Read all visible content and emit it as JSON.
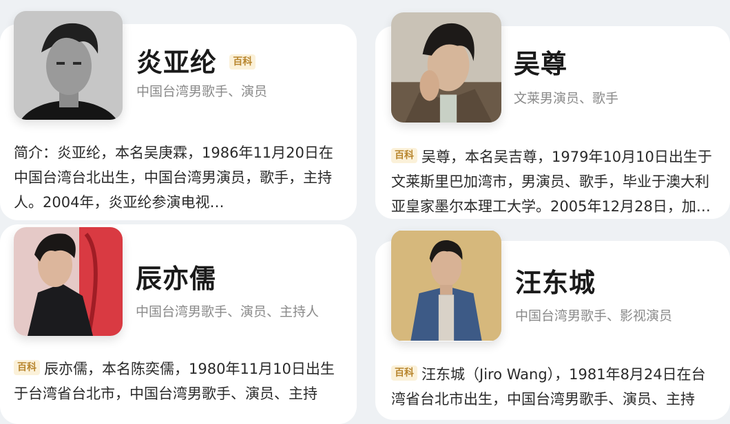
{
  "cards": [
    {
      "name": "炎亚纶",
      "badge": "百科",
      "subtitle": "中国台湾男歌手、演员",
      "desc_prefix": "简介：",
      "desc": "炎亚纶，本名吴庚霖，1986年11月20日在中国台湾台北出生，中国台湾男演员，歌手，主持人。2004年，炎亚纶参演电视…"
    },
    {
      "name": "吴尊",
      "subtitle": "文莱男演员、歌手",
      "badge": "百科",
      "desc": "吴尊，本名吴吉尊，1979年10月10日出生于文莱斯里巴加湾市，男演员、歌手，毕业于澳大利亚皇家墨尔本理工大学。2005年12月28日，加…"
    },
    {
      "name": "辰亦儒",
      "subtitle": "中国台湾男歌手、演员、主持人",
      "badge": "百科",
      "desc": "辰亦儒，本名陈奕儒，1980年11月10日出生于台湾省台北市，中国台湾男歌手、演员、主持"
    },
    {
      "name": "汪东城",
      "subtitle": "中国台湾男歌手、影视演员",
      "badge": "百科",
      "desc": "汪东城（Jiro Wang），1981年8月24日在台湾省台北市出生，中国台湾男歌手、演员、主持"
    }
  ],
  "colors": {
    "badge_text": "#b8862e",
    "badge_bg": "#fbf1d9",
    "subtitle": "#8a8a8a"
  }
}
